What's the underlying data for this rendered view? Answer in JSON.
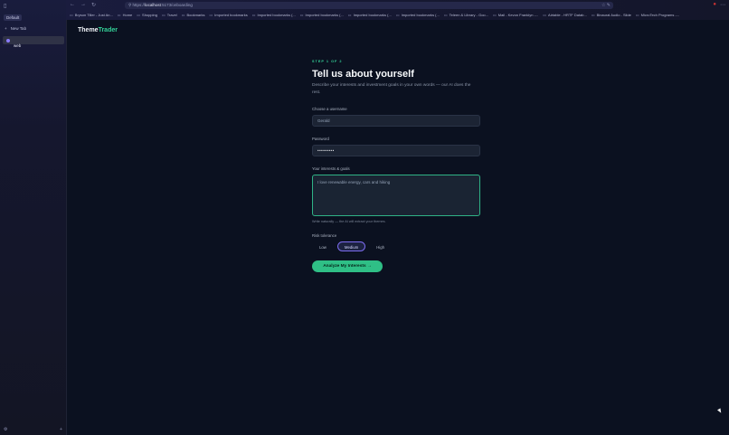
{
  "browser": {
    "workspace_label": "Default",
    "new_tab_label": "New Tab",
    "active_tab_label": "web",
    "url_scheme": "https://",
    "url_host": "localhost",
    "url_path": ":5173/onboarding",
    "bookmarks": [
      "Bryson Tiller - Just An...",
      "Home",
      "Shopping",
      "Travel",
      "Bookmarks",
      "Imported bookmarks",
      "Imported bookmarks (...",
      "Imported bookmarks (...",
      "Imported bookmarks (...",
      "Imported bookmarks (...",
      "Teleen & Library - Goo...",
      "Mail - Kevon Franklyn -...",
      "Airtable - HRTF Datab...",
      "Binaural Audio - Slide",
      "MicroTech Programs -..."
    ]
  },
  "app": {
    "logo_part1": "Theme",
    "logo_part2": "Trader"
  },
  "onboarding": {
    "step_label": "STEP 1 OF 2",
    "title": "Tell us about yourself",
    "description": "Describe your interests and investment goals in your own words — our AI does the rest.",
    "username_label": "Choose a username",
    "username_value": "Gerald",
    "password_label": "Password",
    "password_value": "•••••••••",
    "interests_label": "Your interests & goals",
    "interests_value": "I love renewable energy, cars and hiking",
    "interests_hint": "Write naturally — the AI will extract your themes.",
    "risk_label": "Risk tolerance",
    "risk_options": [
      "Low",
      "Medium",
      "High"
    ],
    "risk_selected": "Medium",
    "cta_label": "Analyze My Interests →"
  },
  "colors": {
    "accent": "#34d399",
    "selected_border": "#7c6cf0",
    "background": "#0b1120"
  }
}
